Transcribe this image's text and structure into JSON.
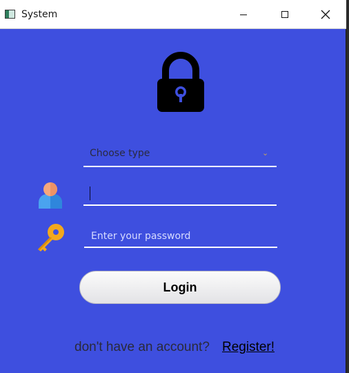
{
  "window": {
    "title": "System",
    "accent_color": "#3e4fdf"
  },
  "icons": {
    "lock": "lock-icon",
    "user": "user-icon",
    "key": "key-icon"
  },
  "form": {
    "type_dropdown": {
      "selected": "Choose type",
      "arrow": "⌄"
    },
    "username": {
      "value": "",
      "placeholder": ""
    },
    "password": {
      "value": "",
      "placeholder": "Enter your password"
    },
    "login_label": "Login"
  },
  "footer": {
    "prompt": "don't have an account?",
    "register_label": "Register!"
  }
}
